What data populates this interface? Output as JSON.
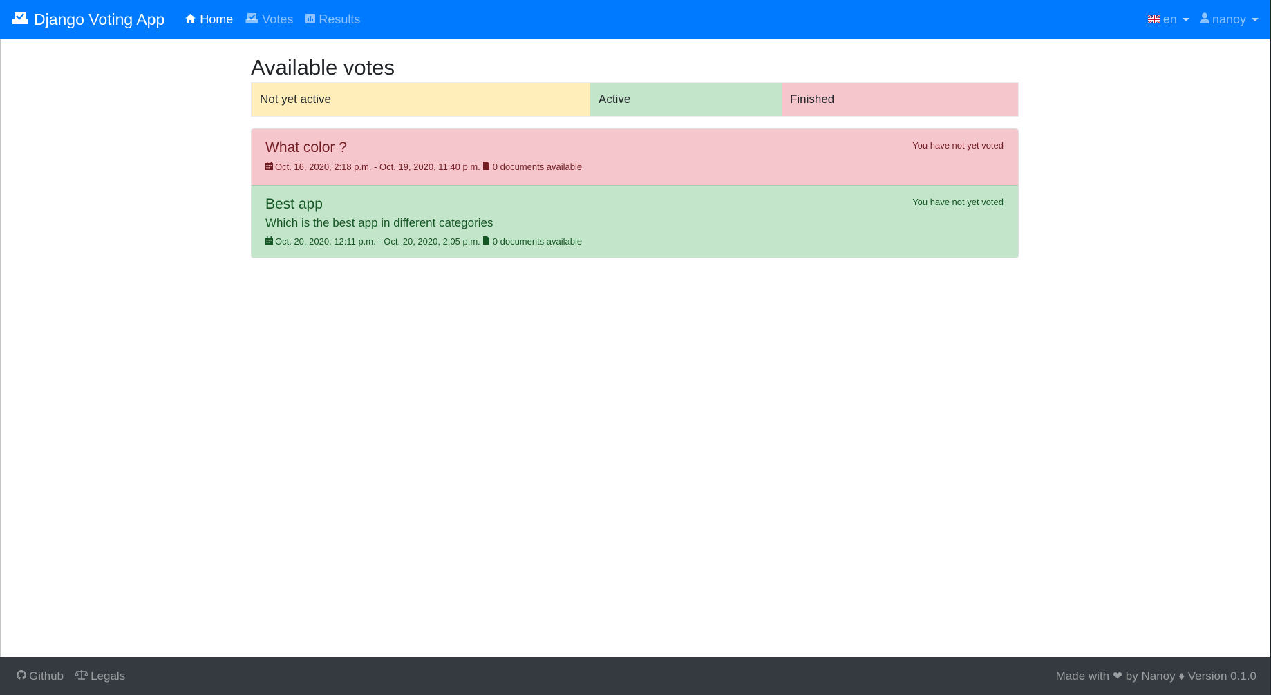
{
  "navbar": {
    "brand": "Django Voting App",
    "links": [
      {
        "label": "Home",
        "icon": "home-icon",
        "active": true
      },
      {
        "label": "Votes",
        "icon": "vote-box-icon",
        "active": false
      },
      {
        "label": "Results",
        "icon": "bar-chart-icon",
        "active": false
      }
    ],
    "language": "en",
    "user": "nanoy"
  },
  "main": {
    "title": "Available votes",
    "legend": {
      "not_active": "Not yet active",
      "active": "Active",
      "finished": "Finished"
    },
    "votes": [
      {
        "title": "What color ?",
        "description": "",
        "status": "You have not yet voted",
        "dates": "Oct. 16, 2020, 2:18 p.m. - Oct. 19, 2020, 11:40 p.m.",
        "documents": "0 documents available",
        "state": "finished"
      },
      {
        "title": "Best app",
        "description": "Which is the best app in different categories",
        "status": "You have not yet voted",
        "dates": "Oct. 20, 2020, 12:11 p.m. - Oct. 20, 2020, 2:05 p.m.",
        "documents": "0 documents available",
        "state": "active"
      }
    ]
  },
  "footer": {
    "github": "Github",
    "legals": "Legals",
    "credit": "Made with ❤ by Nanoy ♦ Version 0.1.0"
  },
  "colors": {
    "navbar": "#007bff",
    "footer": "#343a40",
    "not_active": "#ffeeba",
    "active": "#c3e6cb",
    "finished": "#f5c6cb"
  }
}
